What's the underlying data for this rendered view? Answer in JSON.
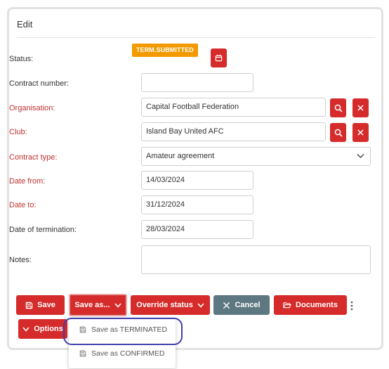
{
  "panel": {
    "title": "Edit"
  },
  "form": {
    "status": {
      "label": "Status:",
      "badge": "TERM.SUBMITTED"
    },
    "contract_number": {
      "label": "Contract number:",
      "value": ""
    },
    "organisation": {
      "label": "Organisation:",
      "value": "Capital Football Federation"
    },
    "club": {
      "label": "Club:",
      "value": "Island Bay United AFC"
    },
    "contract_type": {
      "label": "Contract type:",
      "value": "Amateur agreement"
    },
    "date_from": {
      "label": "Date from:",
      "value": "14/03/2024"
    },
    "date_to": {
      "label": "Date to:",
      "value": "31/12/2024"
    },
    "date_termination": {
      "label": "Date of termination:",
      "value": "28/03/2024"
    },
    "notes": {
      "label": "Notes:",
      "value": ""
    }
  },
  "actions": {
    "save": "Save",
    "save_as": "Save as...",
    "override_status": "Override status",
    "cancel": "Cancel",
    "documents": "Documents",
    "options": "Options"
  },
  "save_as_menu": {
    "items": [
      "Save as TERMINATED",
      "Save as CONFIRMED"
    ]
  },
  "colors": {
    "primary": "#d52b2b",
    "badge": "#f29a00",
    "cancel": "#5e7882",
    "required_label": "#c0302f",
    "highlight": "#3f3fae"
  },
  "icons": [
    "calendar-icon",
    "search-icon",
    "close-icon",
    "chevron-down-icon",
    "floppy-disk-icon",
    "x-icon",
    "folder-open-icon",
    "kebab-icon"
  ]
}
